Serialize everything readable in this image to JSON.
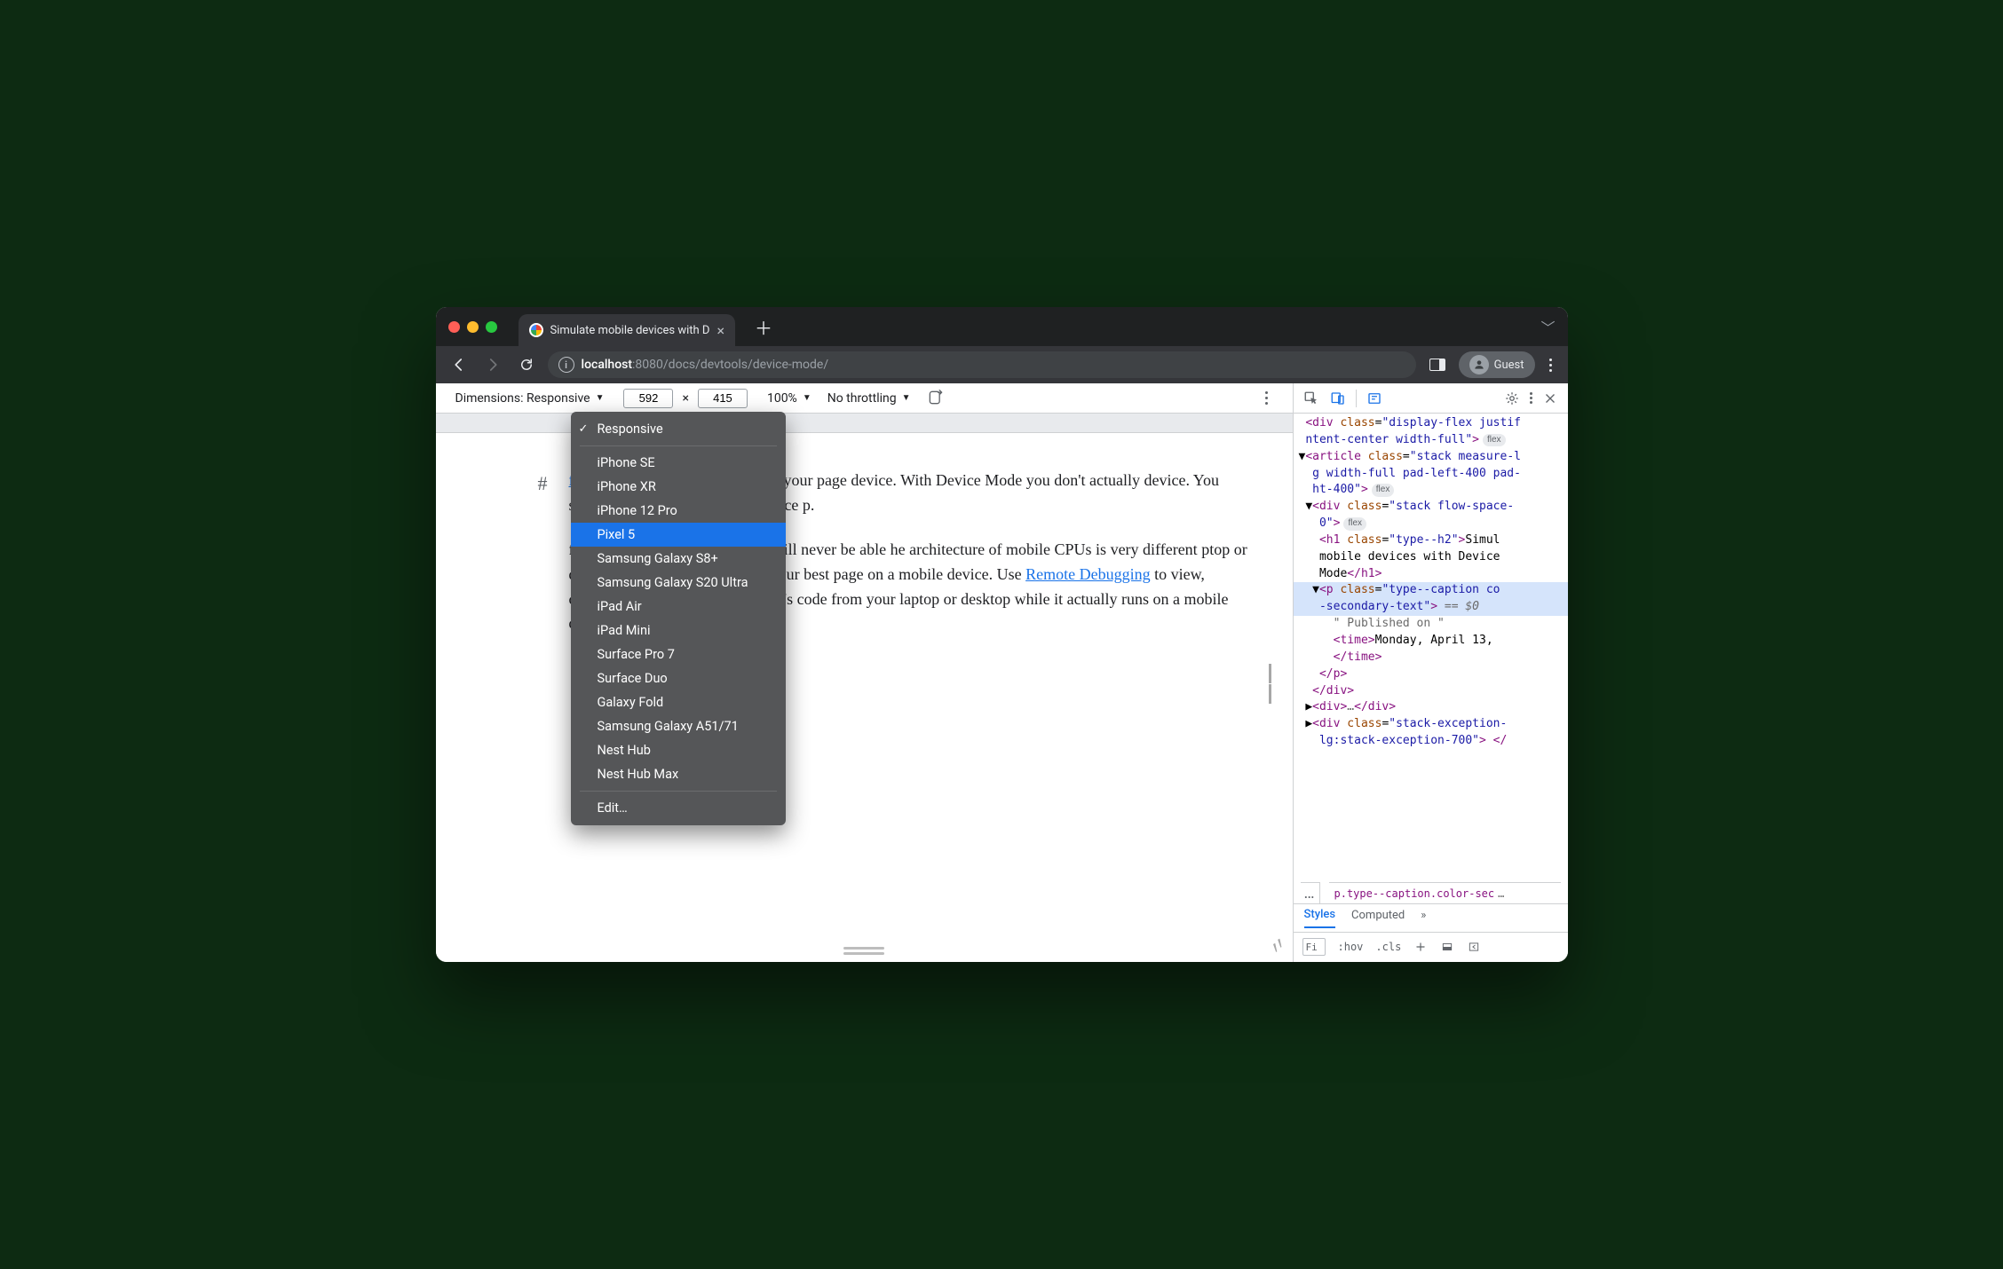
{
  "window": {
    "tab_title": "Simulate mobile devices with D",
    "guest_label": "Guest"
  },
  "url": {
    "prefix": "localhost",
    "port": ":8080",
    "path": "/docs/devtools/device-mode/"
  },
  "device_toolbar": {
    "dimensions_label": "Dimensions: Responsive",
    "width": "592",
    "height": "415",
    "times": " × ",
    "zoom": "100%",
    "throttling": "No throttling"
  },
  "dropdown": {
    "checked": "Responsive",
    "items": [
      "iPhone SE",
      "iPhone XR",
      "iPhone 12 Pro",
      "Pixel 5",
      "Samsung Galaxy S8+",
      "Samsung Galaxy S20 Ultra",
      "iPad Air",
      "iPad Mini",
      "Surface Pro 7",
      "Surface Duo",
      "Galaxy Fold",
      "Samsung Galaxy A51/71",
      "Nest Hub",
      "Nest Hub Max"
    ],
    "highlighted_index": 3,
    "edit": "Edit…"
  },
  "page": {
    "link1": "first-order approximation",
    "p1a": " of how your page device. With Device Mode you don't actually device. You simulate the mobile user experience p.",
    "p2a": "f mobile devices that DevTools will never be able he architecture of mobile CPUs is very different ptop or desktop CPUs. When in doubt, your best page on a mobile device. Use ",
    "link2": "Remote Debugging",
    "p2b": " to view, change, debug, and profile a page's code from your laptop or desktop while it actually runs on a mobile device."
  },
  "elements": {
    "l1": "<div class=\"display-flex justif",
    "l1b": "ntent-center width-full\">",
    "flex": "flex",
    "l2a": "<article class=\"stack measure-l",
    "l2b": "g width-full pad-left-400 pad-",
    "l2c": "ht-400\">",
    "l3a": "<div class=\"stack flow-space-",
    "l3b": "0\">",
    "l4a": "<h1 class=\"type--h2\">Simul",
    "l4b": "mobile devices with Device",
    "l4c": "Mode</h1>",
    "l5a": "<p class=\"type--caption co",
    "l5b": "-secondary-text\">",
    "eq": " == $0",
    "l6": "\" Published on \"",
    "l7a": "<time>Monday, April 13,",
    "l7b": "</time>",
    "l8": "</p>",
    "l9": "</div>",
    "l10": "<div>…</div>",
    "l11a": "<div class=\"stack-exception-",
    "l11b": "lg:stack-exception-700\"> </"
  },
  "breadcrumb": {
    "text": "p.type--caption.color-sec"
  },
  "styles": {
    "tabs": [
      "Styles",
      "Computed"
    ],
    "filter": "Fi",
    "hov": ":hov",
    "cls": ".cls"
  }
}
